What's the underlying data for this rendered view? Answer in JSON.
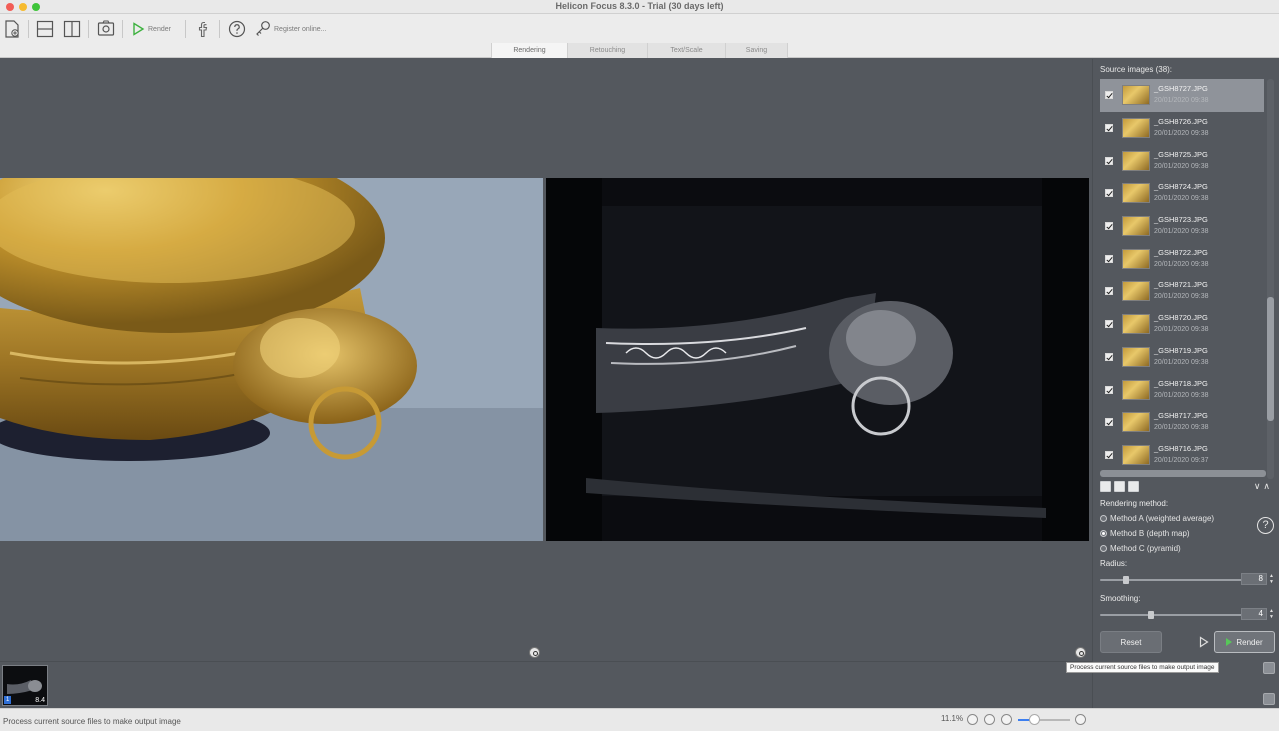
{
  "window": {
    "title": "Helicon Focus 8.3.0 - Trial (30 days left)"
  },
  "toolbar": {
    "render_label": "Render",
    "register_label": "Register online..."
  },
  "tabs": [
    {
      "label": "Rendering",
      "active": true
    },
    {
      "label": "Retouching",
      "active": false
    },
    {
      "label": "Text/Scale",
      "active": false
    },
    {
      "label": "Saving",
      "active": false
    }
  ],
  "panel": {
    "source_title": "Source images (38):",
    "files": [
      {
        "name": "_GSH8727.JPG",
        "date": "20/01/2020 09:38",
        "checked": true,
        "selected": true
      },
      {
        "name": "_GSH8726.JPG",
        "date": "20/01/2020 09:38",
        "checked": true,
        "selected": false
      },
      {
        "name": "_GSH8725.JPG",
        "date": "20/01/2020 09:38",
        "checked": true,
        "selected": false
      },
      {
        "name": "_GSH8724.JPG",
        "date": "20/01/2020 09:38",
        "checked": true,
        "selected": false
      },
      {
        "name": "_GSH8723.JPG",
        "date": "20/01/2020 09:38",
        "checked": true,
        "selected": false
      },
      {
        "name": "_GSH8722.JPG",
        "date": "20/01/2020 09:38",
        "checked": true,
        "selected": false
      },
      {
        "name": "_GSH8721.JPG",
        "date": "20/01/2020 09:38",
        "checked": true,
        "selected": false
      },
      {
        "name": "_GSH8720.JPG",
        "date": "20/01/2020 09:38",
        "checked": true,
        "selected": false
      },
      {
        "name": "_GSH8719.JPG",
        "date": "20/01/2020 09:38",
        "checked": true,
        "selected": false
      },
      {
        "name": "_GSH8718.JPG",
        "date": "20/01/2020 09:38",
        "checked": true,
        "selected": false
      },
      {
        "name": "_GSH8717.JPG",
        "date": "20/01/2020 09:38",
        "checked": true,
        "selected": false
      },
      {
        "name": "_GSH8716.JPG",
        "date": "20/01/2020 09:37",
        "checked": true,
        "selected": false
      }
    ],
    "rendering_method_label": "Rendering method:",
    "methods": [
      {
        "label": "Method A (weighted average)",
        "selected": false
      },
      {
        "label": "Method B (depth map)",
        "selected": true
      },
      {
        "label": "Method C (pyramid)",
        "selected": false
      }
    ],
    "radius_label": "Radius:",
    "radius_value": "8",
    "radius_fraction": 0.17,
    "smoothing_label": "Smoothing:",
    "smoothing_value": "4",
    "smoothing_fraction": 0.35,
    "reset_label": "Reset",
    "render_label": "Render",
    "help_glyph": "?"
  },
  "tooltip": {
    "text": "Process current source files to make output image"
  },
  "thumbnail": {
    "tag": "1",
    "count": "8.4"
  },
  "status": {
    "text": "Process current source files to make output image",
    "zoom": "11.1%",
    "zoom_fraction": 0.3
  },
  "colors": {
    "accent_blue": "#3d7ff0",
    "render_green": "#57c759"
  }
}
